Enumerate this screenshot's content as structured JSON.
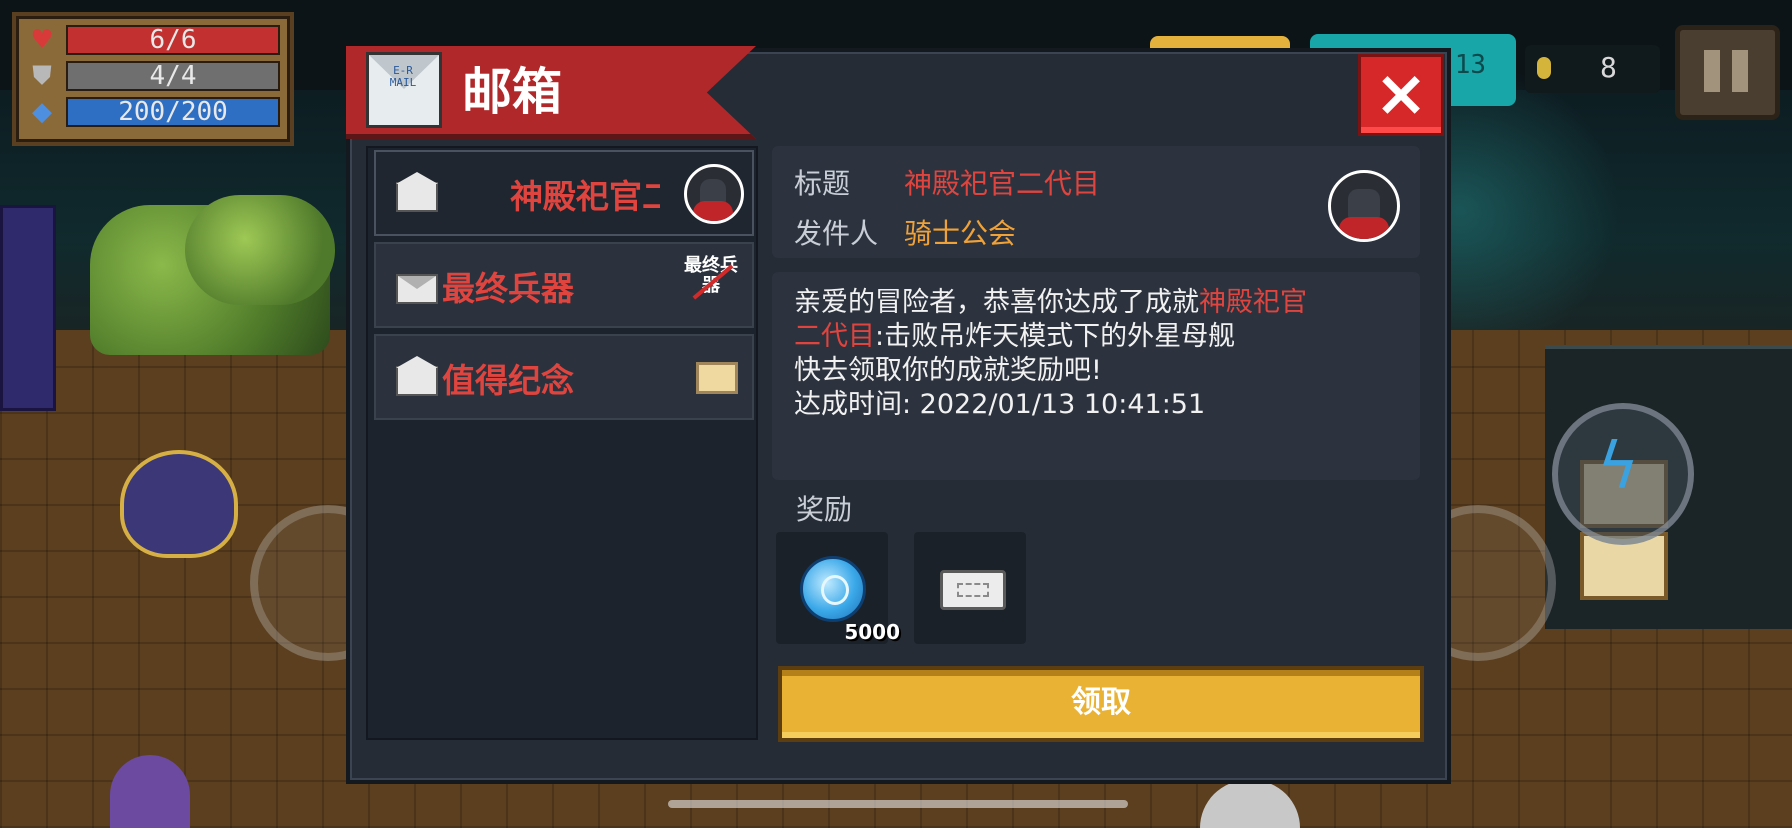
{
  "hud": {
    "hp": "6/6",
    "armor": "4/4",
    "energy": "200/200",
    "coins": "8",
    "gems_partial": "13"
  },
  "mailbox": {
    "title": "邮箱",
    "icon_text": "E-R MAIL",
    "close_label": "×",
    "list": [
      {
        "label": "神殿祀官二",
        "envelope": "open",
        "thumb": "priest-avatar",
        "selected": true
      },
      {
        "label": "最终兵器",
        "envelope": "closed",
        "thumb": "final-weapon",
        "thumb_text": "最终兵器",
        "selected": false
      },
      {
        "label": "值得纪念",
        "envelope": "open",
        "thumb": "tv",
        "selected": false
      }
    ],
    "detail": {
      "title_label": "标题",
      "title_value": "神殿祀官二代目",
      "sender_label": "发件人",
      "sender_value": "骑士公会",
      "body_line1_pre": "亲爱的冒险者，恭喜你达成了成就",
      "body_line1_red": "神殿祀官",
      "body_line2_red": "二代目",
      "body_line2_rest": ":击败吊炸天模式下的外星母舰",
      "body_line3": "快去领取你的成就奖励吧!",
      "body_line4": "达成时间: 2022/01/13 10:41:51",
      "reward_label": "奖励",
      "rewards": [
        {
          "type": "gem",
          "count": "5000"
        },
        {
          "type": "ticket",
          "count": ""
        }
      ],
      "claim_label": "领取"
    }
  },
  "colors": {
    "accent_red": "#e0443e",
    "sender_orange": "#f0a238",
    "claim_yellow": "#e9b234",
    "banner_red": "#b0282a"
  }
}
